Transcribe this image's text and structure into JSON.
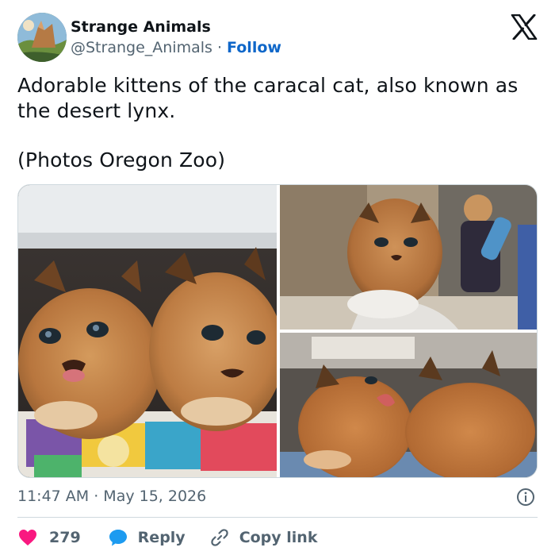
{
  "author": {
    "name": "Strange Animals",
    "handle": "@Strange_Animals",
    "separator": "·",
    "follow_label": "Follow"
  },
  "tweet": {
    "text_line1": "Adorable kittens of the caracal cat, also known as the desert lynx.",
    "text_line2": "(Photos Oregon Zoo)",
    "timestamp": "11:47 AM · May 15, 2026"
  },
  "actions": {
    "like_count": "279",
    "reply_label": "Reply",
    "copy_label": "Copy link"
  },
  "colors": {
    "accent": "#0f67c9",
    "like": "#f91880",
    "reply": "#1d9bf0",
    "secondary_text": "#536471"
  },
  "icons": {
    "logo": "x-logo-icon",
    "info": "info-icon",
    "like": "heart-icon",
    "reply": "speech-bubble-icon",
    "copy": "link-icon"
  }
}
